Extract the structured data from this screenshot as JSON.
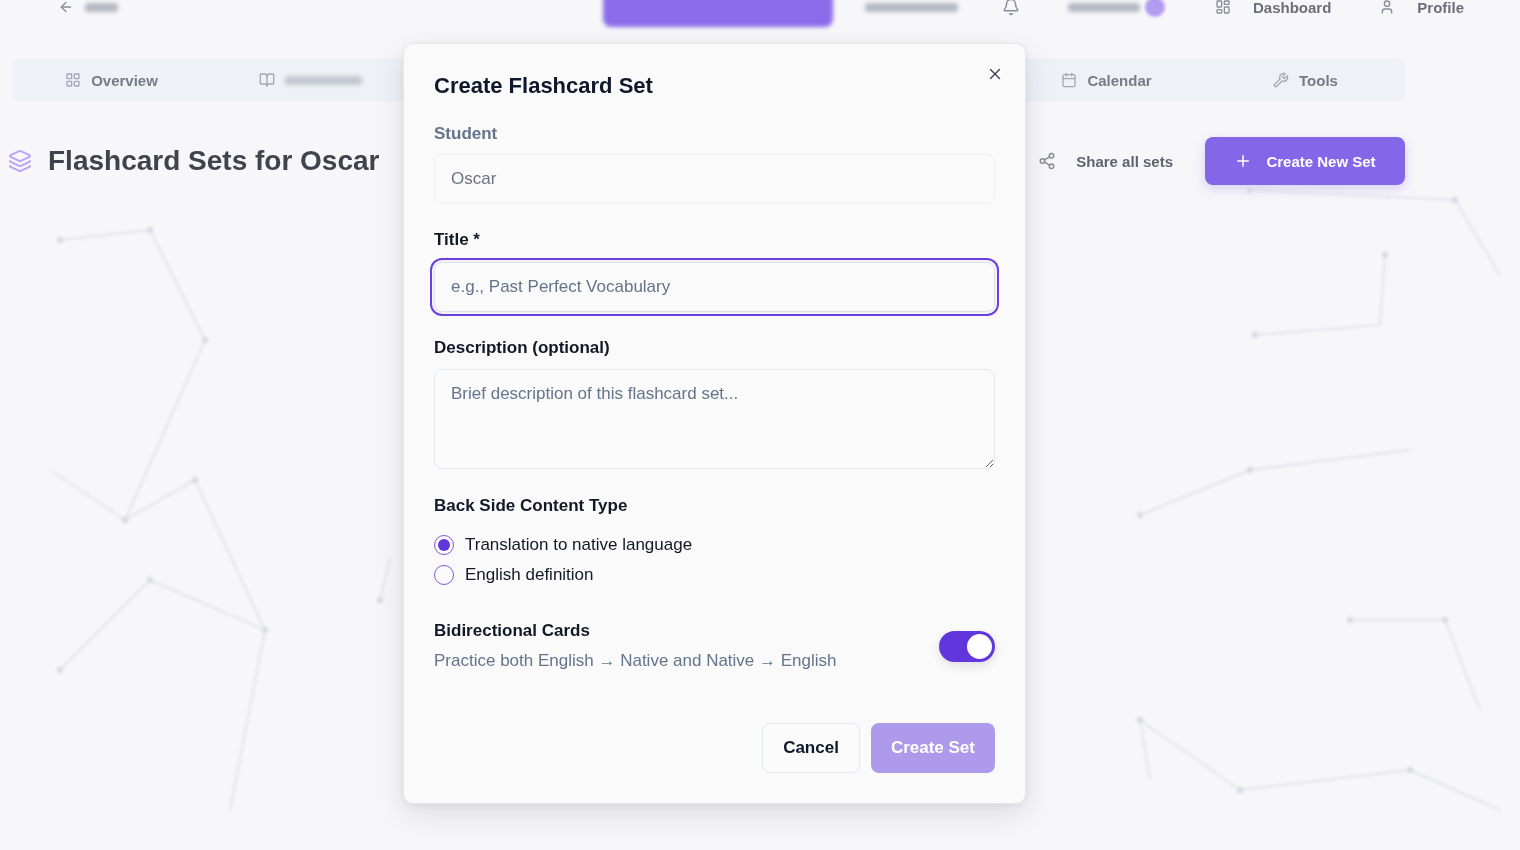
{
  "page": {
    "top_nav": {
      "links": [
        {
          "label": "Dashboard"
        },
        {
          "label": "Profile"
        }
      ]
    },
    "tabs": [
      {
        "label": "Overview"
      },
      {
        "label": "Calendar"
      },
      {
        "label": "Tools"
      }
    ],
    "heading": "Flashcard Sets for Oscar",
    "actions": [
      {
        "kind": "link",
        "label": "Share all sets"
      },
      {
        "kind": "primary",
        "label": "Create New Set"
      }
    ]
  },
  "dialog": {
    "title": "Create Flashcard Set",
    "fields": [
      {
        "kind": "input",
        "label": "Student",
        "value": "Oscar",
        "disabled": true,
        "focused": false
      },
      {
        "kind": "input",
        "label": "Title *",
        "placeholder": "e.g., Past Perfect Vocabulary",
        "disabled": false,
        "focused": true
      },
      {
        "kind": "textarea",
        "label": "Description (optional)",
        "placeholder": "Brief description of this flashcard set...",
        "disabled": false,
        "focused": false
      }
    ],
    "back_side": {
      "label": "Back Side Content Type",
      "options": [
        {
          "label": "Translation to native language",
          "selected": true
        },
        {
          "label": "English definition",
          "selected": false
        }
      ]
    },
    "bidirectional": {
      "label": "Bidirectional Cards",
      "description": "Practice both English → Native and Native → English",
      "on": true
    },
    "buttons": [
      {
        "kind": "secondary",
        "label": "Cancel",
        "disabled": false
      },
      {
        "kind": "primary",
        "label": "Create Set",
        "disabled": true
      }
    ]
  }
}
